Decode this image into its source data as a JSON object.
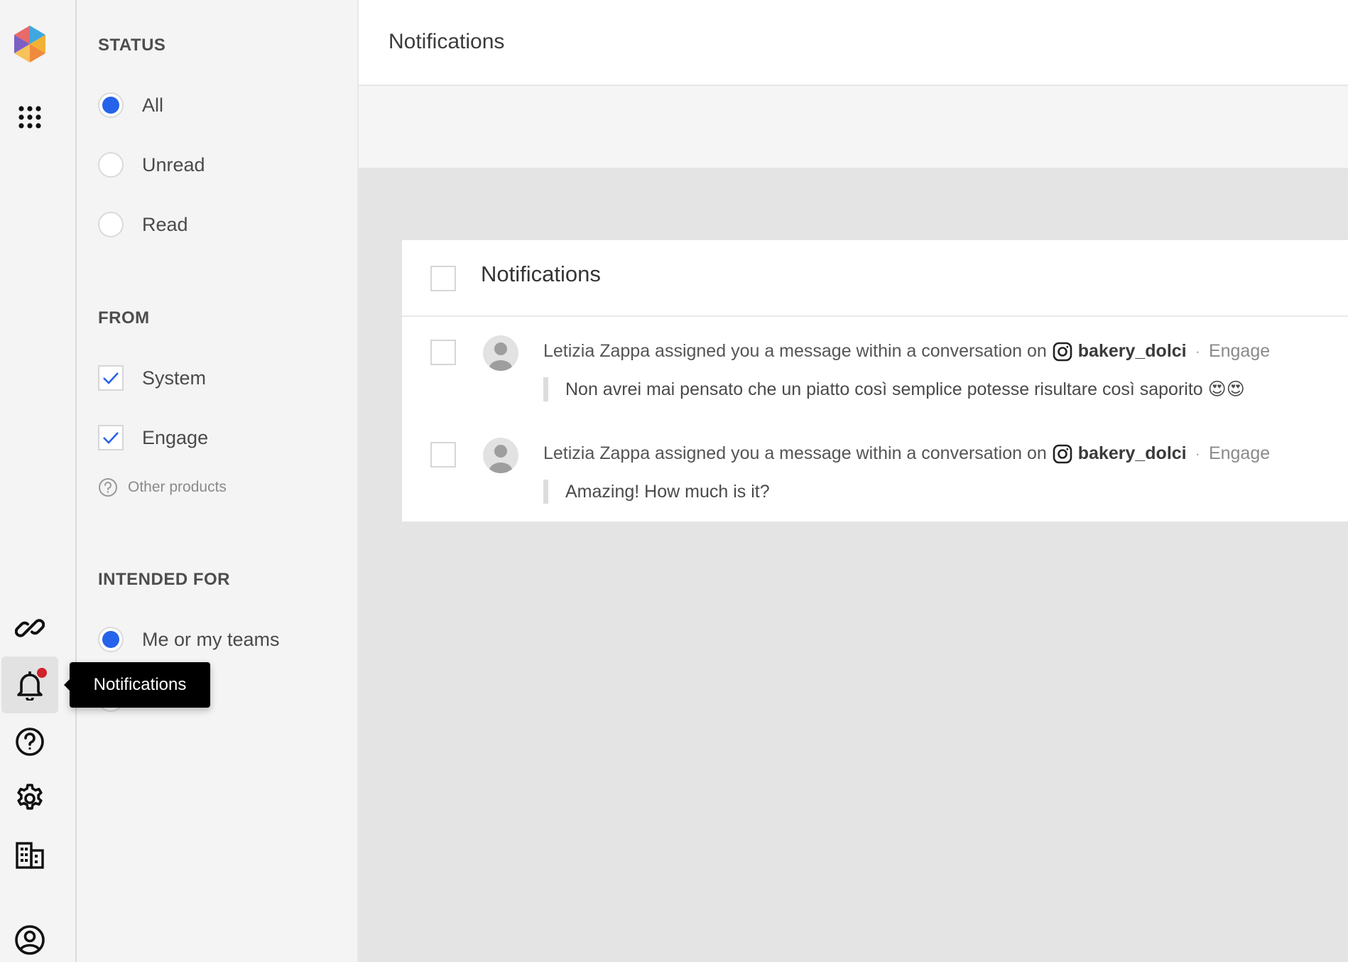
{
  "app": {
    "page_title": "Notifications"
  },
  "rail": {
    "items": [
      {
        "icon": "logo-hex"
      },
      {
        "icon": "apps-grid-icon"
      },
      {
        "icon": "link-icon"
      },
      {
        "icon": "bell-icon",
        "active": true,
        "has_badge": true
      },
      {
        "icon": "help-icon"
      },
      {
        "icon": "gear-icon"
      },
      {
        "icon": "building-icon"
      },
      {
        "icon": "account-icon"
      }
    ],
    "tooltip": "Notifications"
  },
  "filters": {
    "status": {
      "title": "STATUS",
      "options": [
        {
          "label": "All",
          "selected": true
        },
        {
          "label": "Unread",
          "selected": false
        },
        {
          "label": "Read",
          "selected": false
        }
      ]
    },
    "from": {
      "title": "FROM",
      "options": [
        {
          "label": "System",
          "checked": true
        },
        {
          "label": "Engage",
          "checked": true
        }
      ],
      "other_products": "Other products"
    },
    "intended_for": {
      "title": "INTENDED FOR",
      "options": [
        {
          "label": "Me or my teams",
          "selected": true
        }
      ]
    }
  },
  "card": {
    "title": "Notifications",
    "items": [
      {
        "text": "Letizia Zappa assigned you a message within a conversation on",
        "handle": "bakery_dolci",
        "separator": "·",
        "product": "Engage",
        "quote": "Non avrei mai pensato che un piatto così semplice potesse risultare così saporito 😍😍"
      },
      {
        "text": "Letizia Zappa assigned you a message within a conversation on",
        "handle": "bakery_dolci",
        "separator": "·",
        "product": "Engage",
        "quote": "Amazing! How much is it?"
      }
    ]
  },
  "colors": {
    "accent": "#2563eb",
    "badge": "#d0222a",
    "tooltip_bg": "#000000"
  }
}
